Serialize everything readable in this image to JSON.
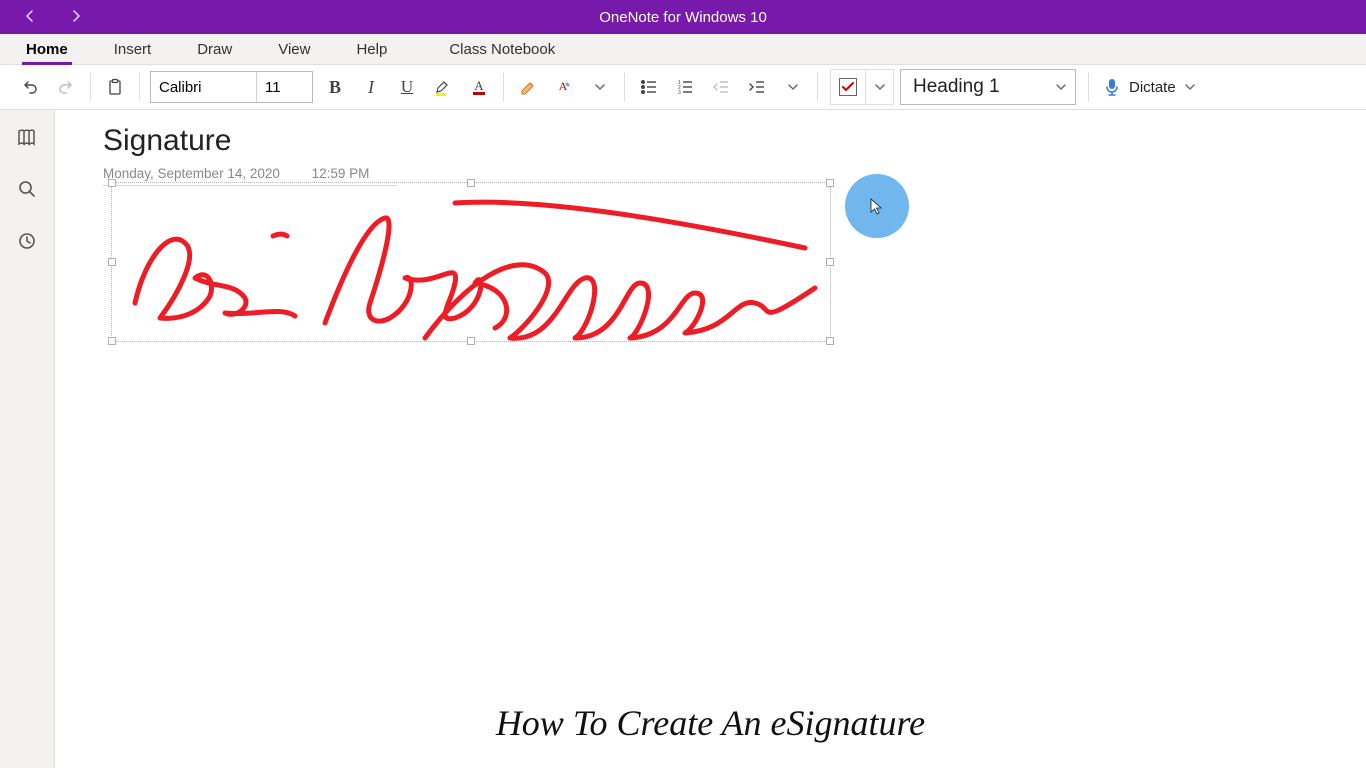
{
  "titlebar": {
    "app_title": "OneNote for Windows 10"
  },
  "menu": {
    "home": "Home",
    "insert": "Insert",
    "draw": "Draw",
    "view": "View",
    "help": "Help",
    "class_notebook": "Class Notebook"
  },
  "ribbon": {
    "font_name": "Calibri",
    "font_size": "11",
    "style_selected": "Heading 1",
    "dictate": "Dictate"
  },
  "page": {
    "title": "Signature",
    "date": "Monday, September 14, 2020",
    "time": "12:59 PM"
  },
  "caption": "How To Create An eSignature",
  "colors": {
    "brand": "#7719AA",
    "accent_highlight": "#62B0EC",
    "ink": "#EE1C25"
  }
}
